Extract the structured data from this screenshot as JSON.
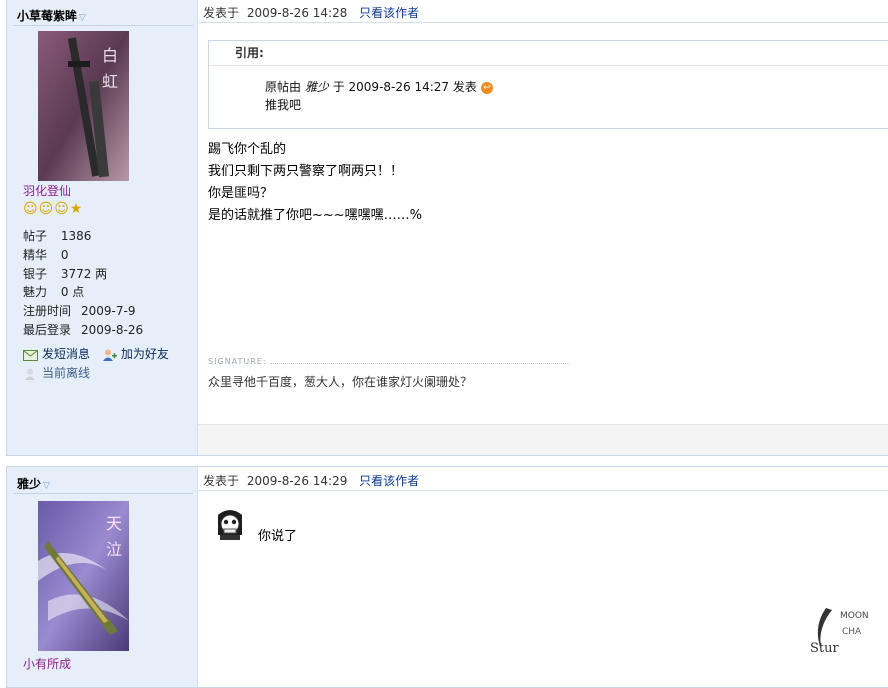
{
  "post1": {
    "username": "小草莓紫眸",
    "dropdown_icon": "chevron-down-icon",
    "rank": "羽化登仙",
    "stats": [
      {
        "label": "帖子",
        "value": "1386"
      },
      {
        "label": "精华",
        "value": "0"
      },
      {
        "label": "银子",
        "value": "3772 两"
      },
      {
        "label": "魅力",
        "value": "0 点"
      },
      {
        "label": "注册时间",
        "value": "2009-7-9"
      },
      {
        "label": "最后登录",
        "value": "2009-8-26"
      }
    ],
    "send_pm": "发短消息",
    "add_friend": "加为好友",
    "status": "当前离线",
    "posted_prefix": "发表于",
    "posted_time": "2009-8-26 14:28",
    "only_author": "只看该作者",
    "quote": {
      "header": "引用:",
      "orig_prefix": "原帖由",
      "orig_user": "雅少",
      "orig_at": "于",
      "orig_time": "2009-8-26 14:27 发表",
      "orig_text": "推我吧"
    },
    "message_lines": [
      "踢飞你个乱的",
      "我们只剩下两只警察了啊两只！！",
      "你是匪吗？",
      "是的话就推了你吧~~~嘿嘿嘿……%"
    ],
    "signature_label": "SIGNATURE:",
    "signature": "众里寻他千百度，葱大人，你在谁家灯火阑珊处？"
  },
  "post2": {
    "username": "雅少",
    "posted_prefix": "发表于",
    "posted_time": "2009-8-26 14:29",
    "only_author": "只看该作者",
    "rank_partial": "小有所成",
    "message": "你说了"
  },
  "colors": {
    "link": "#0b3a8f",
    "rank": "#8a1f8a",
    "sidebar_bg": "#e6eff9"
  }
}
